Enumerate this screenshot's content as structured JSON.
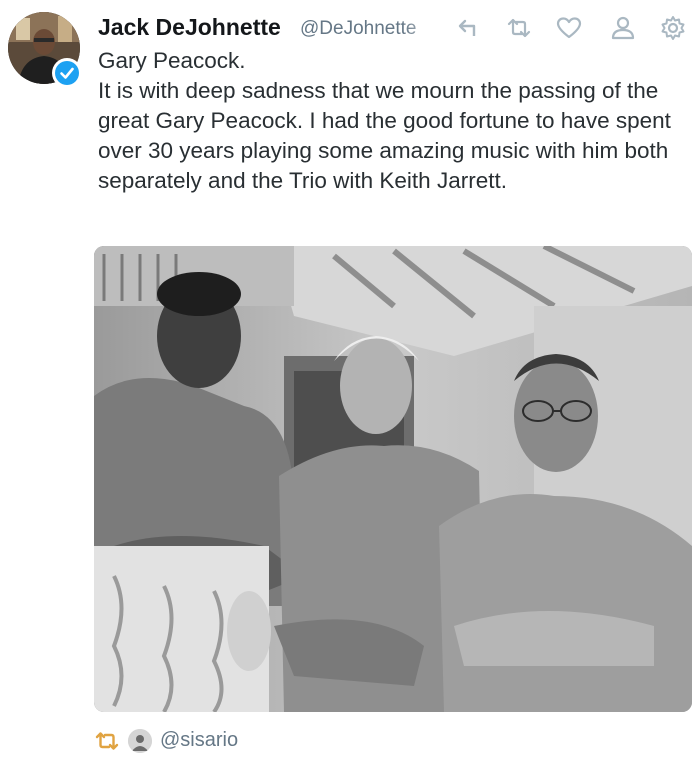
{
  "tweet": {
    "author": {
      "name": "Jack DeJohnette",
      "handle": "@DeJohnette",
      "verified": true
    },
    "text": "Gary Peacock.\nIt is with deep sadness that we mourn the passing of the great Gary Peacock. I had the good fortune to have spent over 30 years playing some amazing music with him both separately and the Trio with Keith Jarrett.",
    "actions": [
      "reply-icon",
      "retweet-icon",
      "like-icon",
      "follow-icon",
      "settings-icon"
    ],
    "footer": {
      "retweeted_by": "@sisario"
    }
  },
  "colors": {
    "verified_blue": "#1da1f2",
    "retweet_orange": "#e0a341",
    "icon_gray": "#aab8c2",
    "text": "#292f33",
    "secondary": "#657786"
  }
}
